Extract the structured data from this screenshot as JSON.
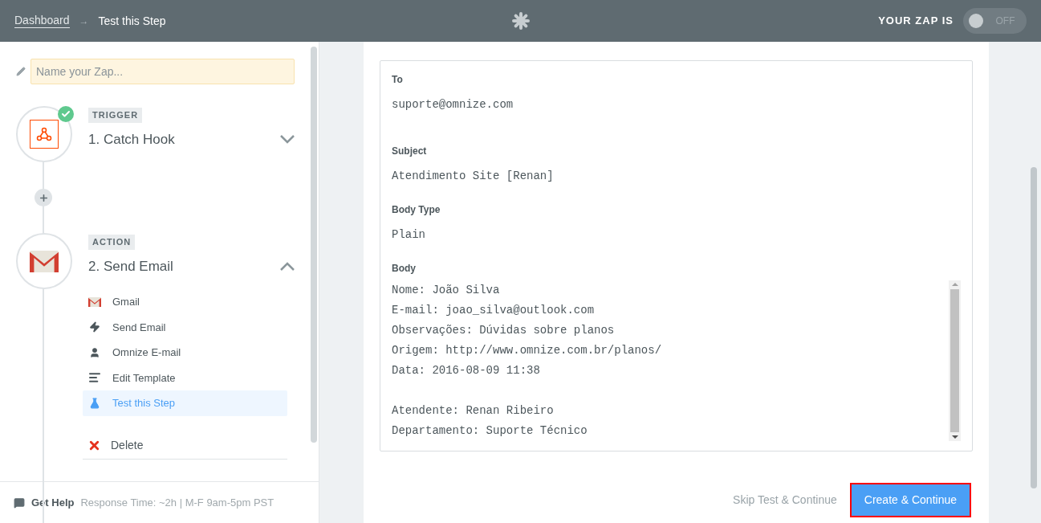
{
  "header": {
    "breadcrumb": "Dashboard",
    "separator": "→",
    "current": "Test this Step",
    "zap_status_label": "YOUR ZAP IS",
    "toggle": {
      "on": false,
      "label": "OFF"
    }
  },
  "sidebar": {
    "name_field": {
      "placeholder": "Name your Zap..."
    },
    "steps": [
      {
        "kind": "trigger",
        "badge": "TRIGGER",
        "title": "1. Catch Hook",
        "checked": true,
        "expanded": false
      },
      {
        "kind": "action",
        "badge": "ACTION",
        "title": "2. Send Email",
        "checked": false,
        "expanded": true,
        "items": [
          {
            "kind": "app",
            "label": "Gmail",
            "selected": false
          },
          {
            "kind": "event",
            "label": "Send Email",
            "selected": false
          },
          {
            "kind": "account",
            "label": "Omnize E-mail",
            "selected": false
          },
          {
            "kind": "template",
            "label": "Edit Template",
            "selected": false
          },
          {
            "kind": "test",
            "label": "Test this Step",
            "selected": true
          }
        ],
        "delete": "Delete"
      }
    ],
    "footer": {
      "label": "Get Help",
      "info": "Response Time: ~2h | M-F 9am-5pm PST"
    }
  },
  "form": {
    "fields": [
      {
        "label": "To",
        "value": "suporte@omnize.com"
      },
      {
        "label": "Subject",
        "value": "Atendimento Site [Renan]"
      },
      {
        "label": "Body Type",
        "value": "Plain"
      }
    ],
    "body": {
      "label": "Body",
      "paragraphs": [
        [
          "Nome: João Silva",
          "E-mail: joao_silva@outlook.com",
          "Observações: Dúvidas sobre planos",
          "Origem: http://www.omnize.com.br/planos/",
          "Data: 2016-08-09 11:38"
        ],
        [
          "Atendente: Renan Ribeiro",
          "Departamento: Suporte Técnico"
        ]
      ]
    },
    "skip_button": "Skip Test & Continue",
    "primary_button": "Create & Continue"
  }
}
